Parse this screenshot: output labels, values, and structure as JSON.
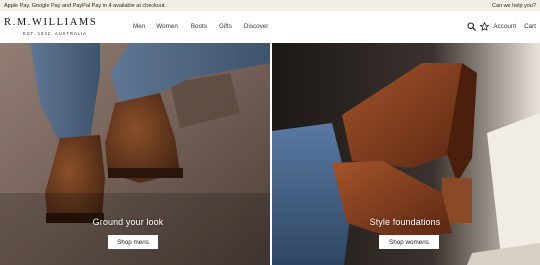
{
  "promo": {
    "message": "Apple Pay, Google Pay and PayPal Pay in 4 available at checkout.",
    "help_link": "Can we help you?"
  },
  "brand": {
    "name": "R.M.WILLIAMS",
    "tagline": "EST. 1932, AUSTRALIA"
  },
  "nav": {
    "items": [
      "Men",
      "Women",
      "Boots",
      "Gifts",
      "Discover"
    ]
  },
  "utilities": {
    "search_icon": "search-icon",
    "wishlist_icon": "star-icon",
    "account_label": "Account",
    "cart_label": "Cart"
  },
  "heroes": [
    {
      "caption": "Ground your look",
      "button": "Shop mens"
    },
    {
      "caption": "Style foundations",
      "button": "Shop womens"
    }
  ],
  "colors": {
    "promo_bg": "#f4efe6",
    "header_bg": "#ffffff",
    "button_bg": "#ffffff",
    "caption_text": "#ffffff"
  }
}
